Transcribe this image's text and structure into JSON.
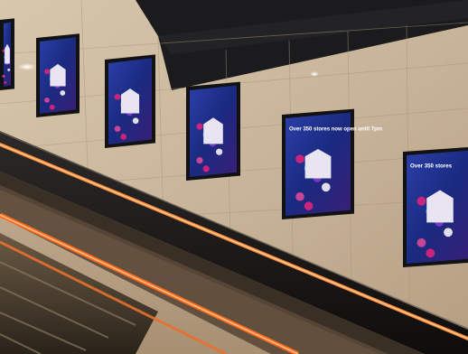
{
  "scene": {
    "screens": [
      {
        "id": "screen-1",
        "headline": ""
      },
      {
        "id": "screen-2",
        "headline": ""
      },
      {
        "id": "screen-3",
        "headline": ""
      },
      {
        "id": "screen-4",
        "headline": ""
      },
      {
        "id": "screen-5",
        "headline": "Over 350 stores now open until 7pm"
      },
      {
        "id": "screen-6",
        "headline": "Over 350 stores"
      }
    ],
    "colors": {
      "wall": "#c8b49c",
      "ceiling": "#1b1b1d",
      "escalator_light": "#ff7a2c",
      "screen_bg": "#1d2e8a",
      "bezel": "#121214"
    }
  }
}
